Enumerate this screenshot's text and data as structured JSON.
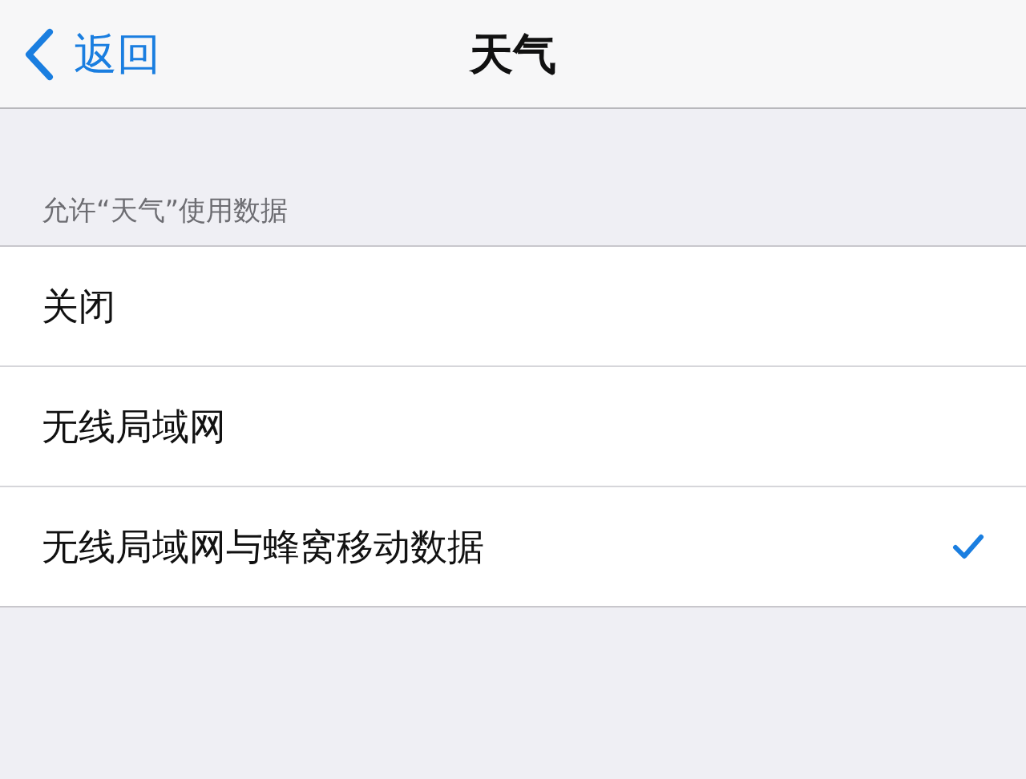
{
  "nav_bar": {
    "back_label": "返回",
    "title": "天气"
  },
  "section": {
    "header": "允许“天气”使用数据",
    "options": [
      {
        "label": "关闭",
        "selected": false
      },
      {
        "label": "无线局域网",
        "selected": false
      },
      {
        "label": "无线局域网与蜂窝移动数据",
        "selected": true
      }
    ]
  }
}
